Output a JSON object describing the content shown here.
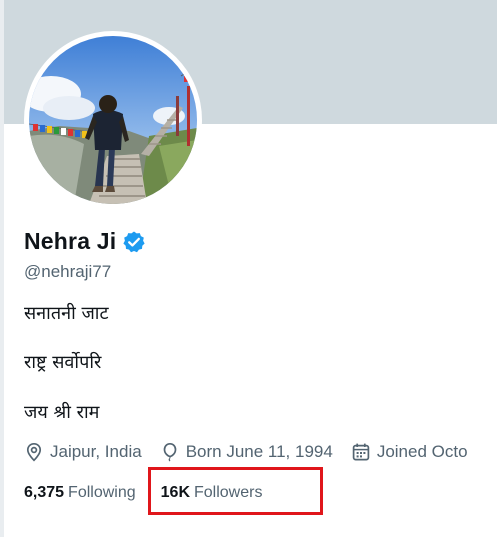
{
  "profile": {
    "display_name": "Nehra Ji",
    "handle": "@nehraji77",
    "verified": true,
    "verified_icon": "verified-badge-icon",
    "avatar_icon": "profile-photo"
  },
  "bio": {
    "lines": [
      "सनातनी जाट",
      "राष्ट्र सर्वोपरि",
      "जय श्री राम"
    ]
  },
  "meta": {
    "location": "Jaipur, India",
    "location_icon": "location-pin-icon",
    "birthday": "Born June 11, 1994",
    "birthday_icon": "balloon-icon",
    "joined": "Joined Octo",
    "joined_icon": "calendar-icon"
  },
  "stats": {
    "following_count": "6,375",
    "following_label": "Following",
    "followers_count": "16K",
    "followers_label": "Followers"
  },
  "colors": {
    "banner": "#cfd9de",
    "verified": "#1d9bf0",
    "secondary_text": "#536471",
    "highlight": "#e0161b"
  }
}
